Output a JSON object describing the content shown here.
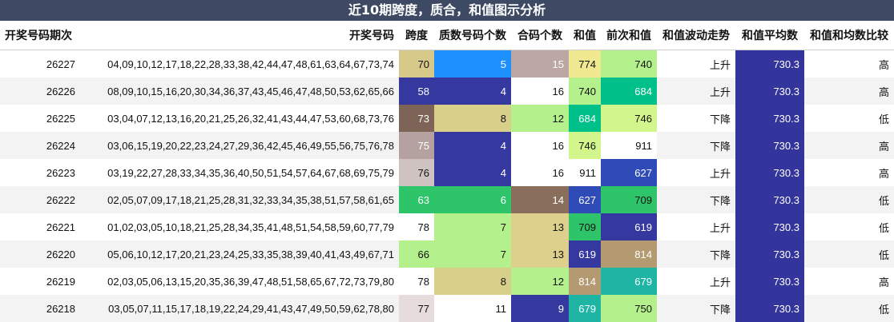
{
  "title": "近10期跨度，质合，和值图示分析",
  "headers": {
    "period": "开奖号码期次",
    "numbers": "开奖号码",
    "span": "跨度",
    "prime": "质数号码个数",
    "composite": "合码个数",
    "sum": "和值",
    "prev_sum": "前次和值",
    "trend": "和值波动走势",
    "avg": "和值平均数",
    "compare": "和值和均数比较"
  },
  "rows": [
    {
      "period": "26227",
      "numbers": "04,09,10,12,17,18,22,28,33,38,42,44,47,48,61,63,64,67,73,74",
      "span": "70",
      "prime": "5",
      "composite": "15",
      "sum": "774",
      "prev_sum": "740",
      "trend": "上升",
      "avg": "730.3",
      "compare": "高"
    },
    {
      "period": "26226",
      "numbers": "08,09,10,15,16,20,30,34,36,37,43,45,46,47,48,50,53,62,65,66",
      "span": "58",
      "prime": "4",
      "composite": "16",
      "sum": "740",
      "prev_sum": "684",
      "trend": "上升",
      "avg": "730.3",
      "compare": "高"
    },
    {
      "period": "26225",
      "numbers": "03,04,07,12,13,16,20,21,25,26,32,41,43,44,47,53,60,68,73,76",
      "span": "73",
      "prime": "8",
      "composite": "12",
      "sum": "684",
      "prev_sum": "746",
      "trend": "下降",
      "avg": "730.3",
      "compare": "低"
    },
    {
      "period": "26224",
      "numbers": "03,06,15,19,20,22,23,24,27,29,36,42,45,46,49,55,56,75,76,78",
      "span": "75",
      "prime": "4",
      "composite": "16",
      "sum": "746",
      "prev_sum": "911",
      "trend": "下降",
      "avg": "730.3",
      "compare": "高"
    },
    {
      "period": "26223",
      "numbers": "03,19,22,27,28,33,34,35,36,40,50,51,54,57,64,67,68,69,75,79",
      "span": "76",
      "prime": "4",
      "composite": "16",
      "sum": "911",
      "prev_sum": "627",
      "trend": "上升",
      "avg": "730.3",
      "compare": "高"
    },
    {
      "period": "26222",
      "numbers": "02,05,07,09,17,18,21,25,28,31,32,33,34,35,38,51,57,58,61,65",
      "span": "63",
      "prime": "6",
      "composite": "14",
      "sum": "627",
      "prev_sum": "709",
      "trend": "下降",
      "avg": "730.3",
      "compare": "低"
    },
    {
      "period": "26221",
      "numbers": "01,02,03,05,10,18,21,25,28,34,35,41,48,51,54,58,59,60,77,79",
      "span": "78",
      "prime": "7",
      "composite": "13",
      "sum": "709",
      "prev_sum": "619",
      "trend": "上升",
      "avg": "730.3",
      "compare": "低"
    },
    {
      "period": "26220",
      "numbers": "05,06,10,12,17,20,21,23,24,25,33,35,38,39,40,41,43,49,67,71",
      "span": "66",
      "prime": "7",
      "composite": "13",
      "sum": "619",
      "prev_sum": "814",
      "trend": "下降",
      "avg": "730.3",
      "compare": "低"
    },
    {
      "period": "26219",
      "numbers": "02,03,05,06,13,15,20,35,36,39,47,48,51,58,65,67,72,73,79,80",
      "span": "78",
      "prime": "8",
      "composite": "12",
      "sum": "814",
      "prev_sum": "679",
      "trend": "上升",
      "avg": "730.3",
      "compare": "高"
    },
    {
      "period": "26218",
      "numbers": "03,05,07,11,15,17,18,19,22,24,29,41,43,47,49,50,59,62,78,80",
      "span": "77",
      "prime": "11",
      "composite": "9",
      "sum": "679",
      "prev_sum": "750",
      "trend": "下降",
      "avg": "730.3",
      "compare": "低"
    }
  ],
  "cell_colors": {
    "span": [
      {
        "bg": "#d6c98a",
        "fg": "#111111"
      },
      {
        "bg": "#35389e",
        "fg": "#ffffff"
      },
      {
        "bg": "#7d6457",
        "fg": "#ffffff"
      },
      {
        "bg": "#b5a2a0",
        "fg": "#ffffff"
      },
      {
        "bg": "#cfc3c2",
        "fg": "#111111"
      },
      {
        "bg": "#2ec46a",
        "fg": "#ffffff"
      },
      {
        "bg": "#ffffff",
        "fg": "#111111"
      },
      {
        "bg": "#b4f08c",
        "fg": "#111111"
      },
      {
        "bg": "#ffffff",
        "fg": "#111111"
      },
      {
        "bg": "#e6dcdc",
        "fg": "#111111"
      }
    ],
    "prime": [
      {
        "bg": "#1e90ff",
        "fg": "#ffffff"
      },
      {
        "bg": "#35389e",
        "fg": "#ffffff"
      },
      {
        "bg": "#d8cf8a",
        "fg": "#111111"
      },
      {
        "bg": "#35389e",
        "fg": "#ffffff"
      },
      {
        "bg": "#35389e",
        "fg": "#ffffff"
      },
      {
        "bg": "#2ec46a",
        "fg": "#ffffff"
      },
      {
        "bg": "#b4f08c",
        "fg": "#111111"
      },
      {
        "bg": "#b4f08c",
        "fg": "#111111"
      },
      {
        "bg": "#d8cf8a",
        "fg": "#111111"
      },
      {
        "bg": "#ffffff",
        "fg": "#111111"
      }
    ],
    "composite": [
      {
        "bg": "#bca7a5",
        "fg": "#ffffff"
      },
      {
        "bg": "#ffffff",
        "fg": "#111111"
      },
      {
        "bg": "#b4f08c",
        "fg": "#111111"
      },
      {
        "bg": "#ffffff",
        "fg": "#111111"
      },
      {
        "bg": "#ffffff",
        "fg": "#111111"
      },
      {
        "bg": "#8a6e5c",
        "fg": "#ffffff"
      },
      {
        "bg": "#ddd08c",
        "fg": "#111111"
      },
      {
        "bg": "#ddd08c",
        "fg": "#111111"
      },
      {
        "bg": "#b4f08c",
        "fg": "#111111"
      },
      {
        "bg": "#35389e",
        "fg": "#ffffff"
      }
    ],
    "sum": [
      {
        "bg": "#f0e992",
        "fg": "#111111"
      },
      {
        "bg": "#b4f08c",
        "fg": "#111111"
      },
      {
        "bg": "#00c08a",
        "fg": "#ffffff"
      },
      {
        "bg": "#d2f58c",
        "fg": "#111111"
      },
      {
        "bg": "#ffffff",
        "fg": "#111111"
      },
      {
        "bg": "#2e4bb8",
        "fg": "#ffffff"
      },
      {
        "bg": "#2ec46a",
        "fg": "#111111"
      },
      {
        "bg": "#35389e",
        "fg": "#ffffff"
      },
      {
        "bg": "#b49a70",
        "fg": "#ffffff"
      },
      {
        "bg": "#1fb5a5",
        "fg": "#ffffff"
      }
    ],
    "prev_sum": [
      {
        "bg": "#b4f08c",
        "fg": "#111111"
      },
      {
        "bg": "#00c08a",
        "fg": "#ffffff"
      },
      {
        "bg": "#d2f58c",
        "fg": "#111111"
      },
      {
        "bg": "#ffffff",
        "fg": "#111111"
      },
      {
        "bg": "#2e4bb8",
        "fg": "#ffffff"
      },
      {
        "bg": "#2ec46a",
        "fg": "#111111"
      },
      {
        "bg": "#35389e",
        "fg": "#ffffff"
      },
      {
        "bg": "#b49a70",
        "fg": "#ffffff"
      },
      {
        "bg": "#1fb5a5",
        "fg": "#ffffff"
      },
      {
        "bg": "#b4f08c",
        "fg": "#111111"
      }
    ],
    "avg": {
      "bg": "#33349c",
      "fg": "#ffffff"
    }
  }
}
